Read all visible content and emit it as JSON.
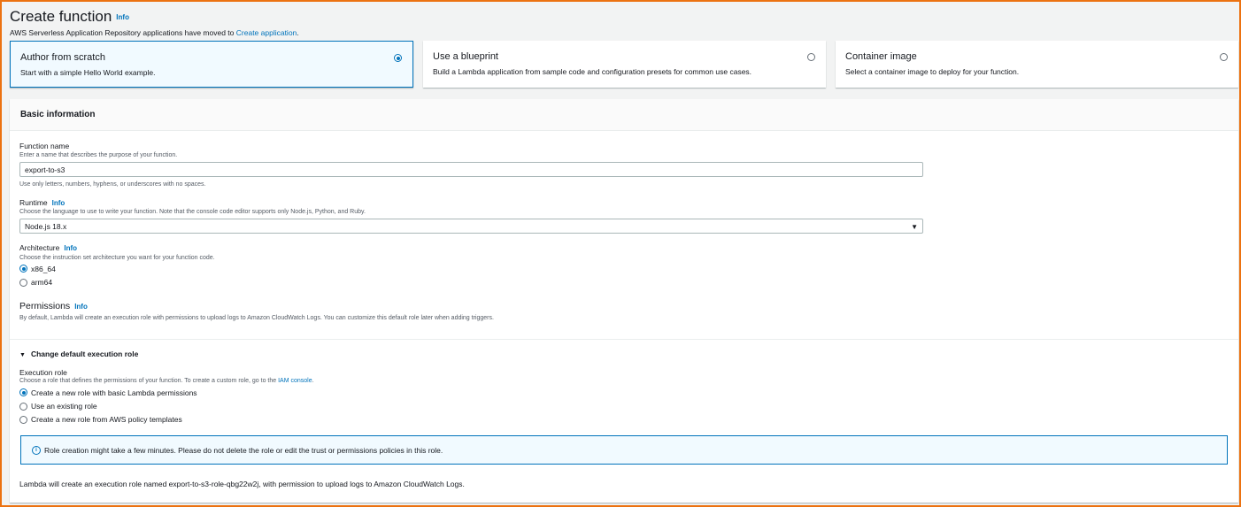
{
  "header": {
    "title": "Create function",
    "info": "Info",
    "notice_text": "AWS Serverless Application Repository applications have moved to ",
    "notice_link": "Create application",
    "notice_end": "."
  },
  "options": [
    {
      "title": "Author from scratch",
      "desc": "Start with a simple Hello World example.",
      "selected": true
    },
    {
      "title": "Use a blueprint",
      "desc": "Build a Lambda application from sample code and configuration presets for common use cases.",
      "selected": false
    },
    {
      "title": "Container image",
      "desc": "Select a container image to deploy for your function.",
      "selected": false
    }
  ],
  "basic": {
    "heading": "Basic information",
    "function_name": {
      "label": "Function name",
      "desc": "Enter a name that describes the purpose of your function.",
      "value": "export-to-s3",
      "hint": "Use only letters, numbers, hyphens, or underscores with no spaces."
    },
    "runtime": {
      "label": "Runtime",
      "info": "Info",
      "desc": "Choose the language to use to write your function. Note that the console code editor supports only Node.js, Python, and Ruby.",
      "value": "Node.js 18.x"
    },
    "architecture": {
      "label": "Architecture",
      "info": "Info",
      "desc": "Choose the instruction set architecture you want for your function code.",
      "options": [
        "x86_64",
        "arm64"
      ],
      "selected": 0
    },
    "permissions": {
      "label": "Permissions",
      "info": "Info",
      "desc": "By default, Lambda will create an execution role with permissions to upload logs to Amazon CloudWatch Logs. You can customize this default role later when adding triggers."
    },
    "exec_section": {
      "toggle_label": "Change default execution role",
      "label": "Execution role",
      "desc": "Choose a role that defines the permissions of your function. To create a custom role, go to the ",
      "desc_link": "IAM console",
      "desc_end": ".",
      "options": [
        "Create a new role with basic Lambda permissions",
        "Use an existing role",
        "Create a new role from AWS policy templates"
      ],
      "selected": 0
    },
    "alert": "Role creation might take a few minutes. Please do not delete the role or edit the trust or permissions policies in this role.",
    "footer": "Lambda will create an execution role named export-to-s3-role-qbg22w2j, with permission to upload logs to Amazon CloudWatch Logs."
  },
  "colors": {
    "accent": "#0073bb",
    "frame": "#ec7211",
    "selected_bg": "#f1faff"
  }
}
